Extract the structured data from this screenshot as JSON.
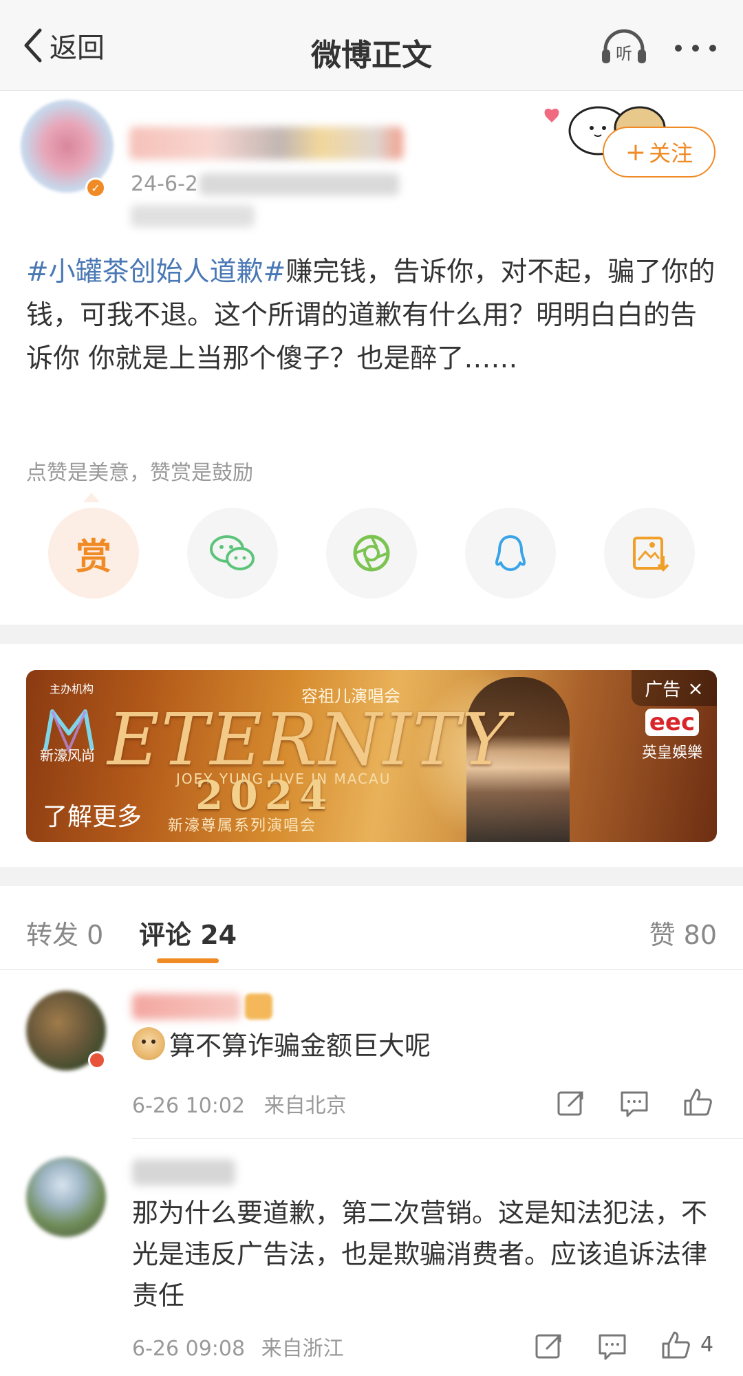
{
  "nav": {
    "back_label": "返回",
    "title": "微博正文",
    "listen_label": "听"
  },
  "post": {
    "date_prefix": "24-6-2",
    "verified_mark": "✓",
    "follow_label": "关注",
    "hashtag": "#小罐茶创始人道歉#",
    "body": "赚完钱，告诉你，对不起，骗了你的钱，可我不退。这个所谓的道歉有什么用？明明白白的告诉你 你就是上当那个傻子？也是醉了……",
    "reward_hint": "点赞是美意，赞赏是鼓励",
    "reward_button": "赏"
  },
  "share": {
    "buttons": [
      "reward",
      "wechat",
      "moments",
      "qq",
      "save-image"
    ]
  },
  "ad": {
    "organizer": "主办机构",
    "logo_text": "新濠风尚",
    "title": "ETERNITY",
    "subtitle_top": "容祖儿演唱会",
    "subtitle_mid": "JOEY YUNG LIVE IN MACAU",
    "year": "2024",
    "subtitle_bottom": "新濠尊属系列演唱会",
    "learn_more": "了解更多",
    "tag": "广告",
    "brand_logo": "eec",
    "brand_name": "英皇娛樂"
  },
  "tabs": {
    "repost": "转发 0",
    "comments": "评论 24",
    "likes": "赞 80"
  },
  "comments": [
    {
      "text": "算不算诈骗金额巨大呢",
      "time": "6-26 10:02",
      "location": "来自北京",
      "like_count": ""
    },
    {
      "text": "那为什么要道歉，第二次营销。这是知法犯法，不光是违反广告法，也是欺骗消费者。应该追诉法律责任",
      "time": "6-26 09:08",
      "location": "来自浙江",
      "like_count": "4"
    }
  ],
  "colors": {
    "accent": "#f08a24",
    "hashtag": "#4a78b5",
    "text": "#333333",
    "muted": "#999999"
  }
}
